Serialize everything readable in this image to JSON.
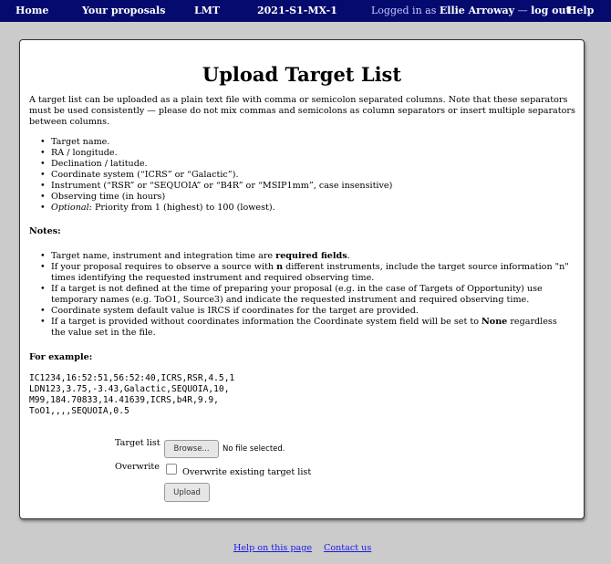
{
  "nav": {
    "home": "Home",
    "proposals": "Your proposals",
    "facility": "LMT",
    "semester": "2021-S1-MX-1",
    "logged_in_prefix": "Logged in as",
    "user_name": "Ellie Arroway",
    "separator": "—",
    "logout": "log out",
    "help": "Help"
  },
  "page": {
    "title": "Upload Target List",
    "intro": "A target list can be uploaded as a plain text file with comma or semicolon separated columns. Note that these separators must be used consistently — please do not mix commas and semicolons as column separators or insert multiple separators between columns.",
    "columns": [
      "Target name.",
      "RA / longitude.",
      "Declination / latitude.",
      "Coordinate system (“ICRS” or “Galactic”).",
      "Instrument (“RSR” or “SEQUOIA” or “B4R” or “MSIP1mm”, case insensitive)",
      "Observing time (in hours)"
    ],
    "optional_label": "Optional:",
    "optional_text": " Priority from 1 (highest) to 100 (lowest).",
    "notes_heading": "Notes:",
    "note1_pre": "Target name, instrument and integration time are ",
    "note1_bold": "required fields",
    "note1_post": ".",
    "note2_pre": "If your proposal requires to observe a source with ",
    "note2_bold": "n",
    "note2_post": " different instruments, include the target source information \"n\" times identifying the requested instrument and required observing time.",
    "note3": "If a target is not defined at the time of preparing your proposal (e.g. in the case of Targets of Opportunity) use temporary names (e.g. ToO1, Source3) and indicate the requested instrument and required observing time.",
    "note4": "Coordinate system default value is IRCS if coordinates for the target are provided.",
    "note5_pre": "If a target is provided without coordinates information the Coordinate system field will be set to ",
    "note5_bold": "None",
    "note5_post": " regardless the value set in the file.",
    "example_heading": "For example:",
    "example_text": "IC1234,16:52:51,56:52:40,ICRS,RSR,4.5,1\nLDN123,3.75,-3.43,Galactic,SEQUOIA,10,\nM99,184.70833,14.41639,ICRS,b4R,9.9,\nToO1,,,,SEQUOIA,0.5"
  },
  "form": {
    "target_list_label": "Target list",
    "browse_label": "Browse...",
    "file_status": "No file selected.",
    "overwrite_label": "Overwrite",
    "overwrite_checkbox_label": "Overwrite existing target list",
    "upload_label": "Upload"
  },
  "footer": {
    "help_link": "Help on this page",
    "contact_link": "Contact us"
  }
}
